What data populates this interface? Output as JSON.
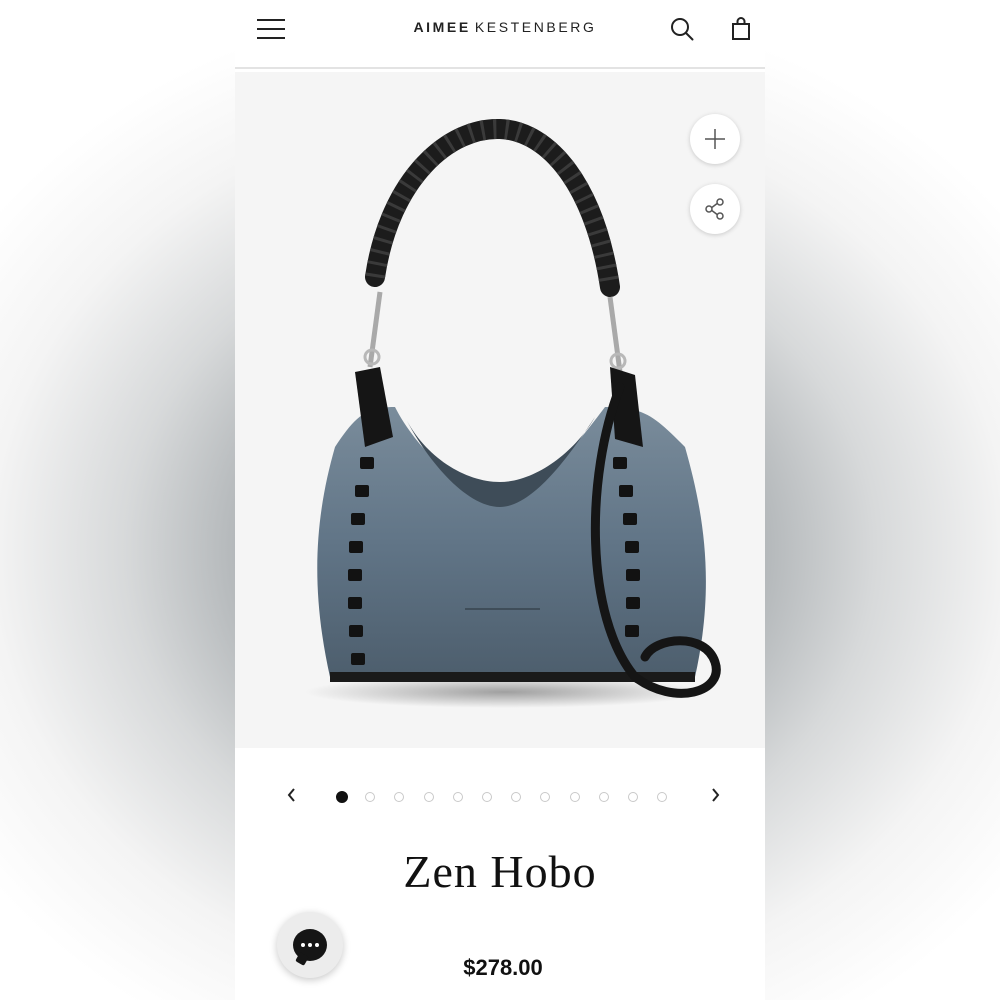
{
  "header": {
    "brand_bold": "AIMEE",
    "brand_light": "KESTENBERG",
    "menu_icon": "hamburger-menu-icon",
    "search_icon": "search-icon",
    "cart_icon": "shopping-bag-icon"
  },
  "gallery": {
    "image_subject": "denim hobo bag with black leather trim",
    "zoom_icon": "plus-icon",
    "share_icon": "share-icon",
    "prev_icon": "chevron-left-icon",
    "next_icon": "chevron-right-icon",
    "total_images": 12,
    "active_index": 0
  },
  "product": {
    "title": "Zen Hobo",
    "price": "$278.00"
  },
  "chat": {
    "icon": "chat-bubble-icon"
  },
  "colors": {
    "text": "#111111",
    "denim": "#5a6e80",
    "leather": "#1a1a1a",
    "divider": "#e3e3e3"
  }
}
